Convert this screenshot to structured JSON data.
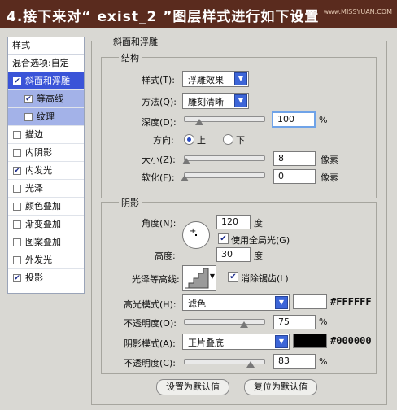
{
  "banner": {
    "title": "4.接下来对“ exist_2 ”图层样式进行如下设置",
    "watermark": "www.MISSYUAN.COM"
  },
  "left_panel": {
    "header": "样式",
    "blend_options": "混合选项:自定",
    "items": [
      {
        "label": "斜面和浮雕",
        "checked": true,
        "state": "selected"
      },
      {
        "label": "等高线",
        "checked": true,
        "state": "sub"
      },
      {
        "label": "纹理",
        "checked": false,
        "state": "sub"
      },
      {
        "label": "描边",
        "checked": false
      },
      {
        "label": "内阴影",
        "checked": false
      },
      {
        "label": "内发光",
        "checked": true
      },
      {
        "label": "光泽",
        "checked": false
      },
      {
        "label": "颜色叠加",
        "checked": false
      },
      {
        "label": "渐变叠加",
        "checked": false
      },
      {
        "label": "图案叠加",
        "checked": false
      },
      {
        "label": "外发光",
        "checked": false
      },
      {
        "label": "投影",
        "checked": true
      }
    ],
    "check_glyph": "✔"
  },
  "bevel": {
    "title": "斜面和浮雕",
    "structure": {
      "title": "结构",
      "style_label": "样式(T):",
      "style_value": "浮雕效果",
      "method_label": "方法(Q):",
      "method_value": "雕刻清晰",
      "depth_label": "深度(D):",
      "depth_value": "100",
      "depth_unit": "%",
      "direction_label": "方向:",
      "dir_up": "上",
      "dir_down": "下",
      "size_label": "大小(Z):",
      "size_value": "8",
      "size_unit": "像素",
      "soften_label": "软化(F):",
      "soften_value": "0",
      "soften_unit": "像素"
    },
    "shading": {
      "title": "阴影",
      "angle_label": "角度(N):",
      "angle_value": "120",
      "angle_unit": "度",
      "global_light_label": "使用全局光(G)",
      "altitude_label": "高度:",
      "altitude_value": "30",
      "altitude_unit": "度",
      "gloss_label": "光泽等高线:",
      "antialias_label": "消除锯齿(L)",
      "highlight_label": "高光模式(H):",
      "highlight_value": "滤色",
      "highlight_color": "#FFFFFF",
      "highlight_hex": "#FFFFFF",
      "hl_opacity_label": "不透明度(O):",
      "hl_opacity_value": "75",
      "hl_opacity_unit": "%",
      "shadow_label": "阴影模式(A):",
      "shadow_value": "正片叠底",
      "shadow_color": "#000000",
      "shadow_hex": "#000000",
      "sh_opacity_label": "不透明度(C):",
      "sh_opacity_value": "83",
      "sh_opacity_unit": "%"
    },
    "buttons": {
      "make_default": "设置为默认值",
      "reset_default": "复位为默认值"
    }
  }
}
